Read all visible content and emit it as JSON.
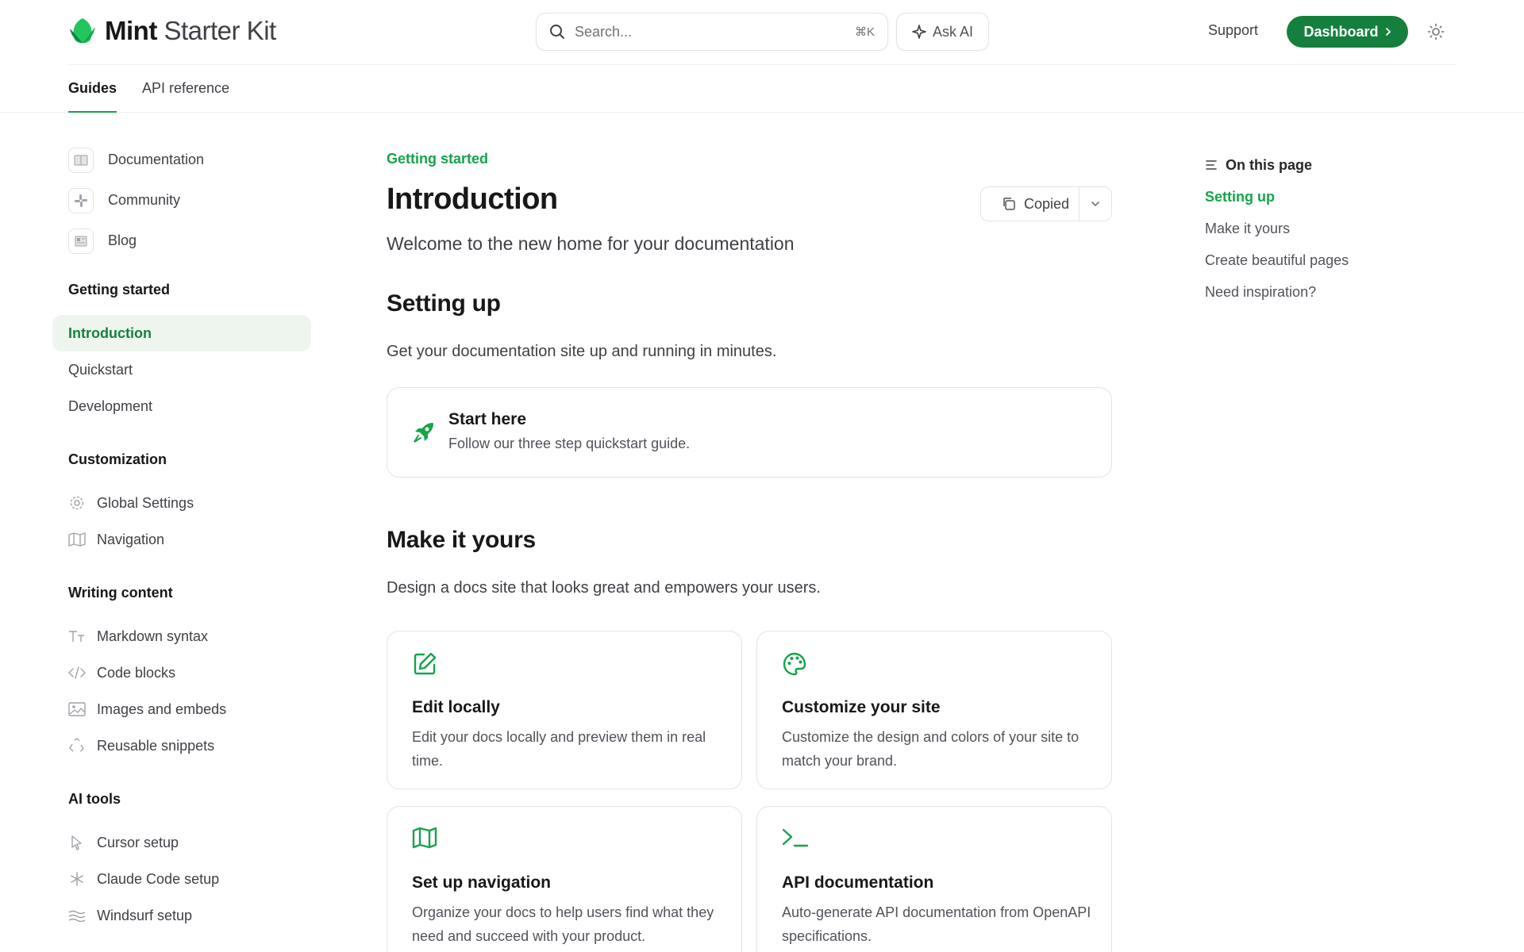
{
  "brand": {
    "name_bold": "Mint",
    "name_light": "Starter Kit",
    "accent": "#16a34a",
    "button_color": "#15803d"
  },
  "search": {
    "placeholder": "Search...",
    "shortcut": "⌘K"
  },
  "header": {
    "ask_ai": "Ask AI",
    "support": "Support",
    "dashboard": "Dashboard"
  },
  "tabs": [
    {
      "label": "Guides",
      "active": true
    },
    {
      "label": "API reference",
      "active": false
    }
  ],
  "sidebar": {
    "top_links": [
      {
        "label": "Documentation",
        "icon": "book-icon"
      },
      {
        "label": "Community",
        "icon": "slack-icon"
      },
      {
        "label": "Blog",
        "icon": "newspaper-icon"
      }
    ],
    "sections": [
      {
        "title": "Getting started",
        "items": [
          {
            "label": "Introduction",
            "active": true
          },
          {
            "label": "Quickstart"
          },
          {
            "label": "Development"
          }
        ]
      },
      {
        "title": "Customization",
        "items": [
          {
            "label": "Global Settings",
            "icon": "gear-icon"
          },
          {
            "label": "Navigation",
            "icon": "map-icon"
          }
        ]
      },
      {
        "title": "Writing content",
        "items": [
          {
            "label": "Markdown syntax",
            "icon": "text-size-icon"
          },
          {
            "label": "Code blocks",
            "icon": "code-icon"
          },
          {
            "label": "Images and embeds",
            "icon": "image-icon"
          },
          {
            "label": "Reusable snippets",
            "icon": "recycle-icon"
          }
        ]
      },
      {
        "title": "AI tools",
        "items": [
          {
            "label": "Cursor setup",
            "icon": "pointer-icon"
          },
          {
            "label": "Claude Code setup",
            "icon": "asterisk-icon"
          },
          {
            "label": "Windsurf setup",
            "icon": "waves-icon"
          }
        ]
      }
    ]
  },
  "main": {
    "breadcrumb": "Getting started",
    "title": "Introduction",
    "copy_button": "Copied",
    "subtitle": "Welcome to the new home for your documentation",
    "setting_up": {
      "heading": "Setting up",
      "text": "Get your documentation site up and running in minutes.",
      "card": {
        "title": "Start here",
        "description": "Follow our three step quickstart guide.",
        "icon": "rocket-icon"
      }
    },
    "make_it_yours": {
      "heading": "Make it yours",
      "text": "Design a docs site that looks great and empowers your users.",
      "cards": [
        {
          "title": "Edit locally",
          "description": "Edit your docs locally and preview them in real time.",
          "icon": "edit-icon"
        },
        {
          "title": "Customize your site",
          "description": "Customize the design and colors of your site to match your brand.",
          "icon": "palette-icon"
        },
        {
          "title": "Set up navigation",
          "description": "Organize your docs to help users find what they need and succeed with your product.",
          "icon": "map-icon"
        },
        {
          "title": "API documentation",
          "description": "Auto-generate API documentation from OpenAPI specifications.",
          "icon": "terminal-icon"
        }
      ]
    }
  },
  "toc": {
    "heading": "On this page",
    "items": [
      {
        "label": "Setting up",
        "active": true
      },
      {
        "label": "Make it yours"
      },
      {
        "label": "Create beautiful pages"
      },
      {
        "label": "Need inspiration?"
      }
    ]
  }
}
